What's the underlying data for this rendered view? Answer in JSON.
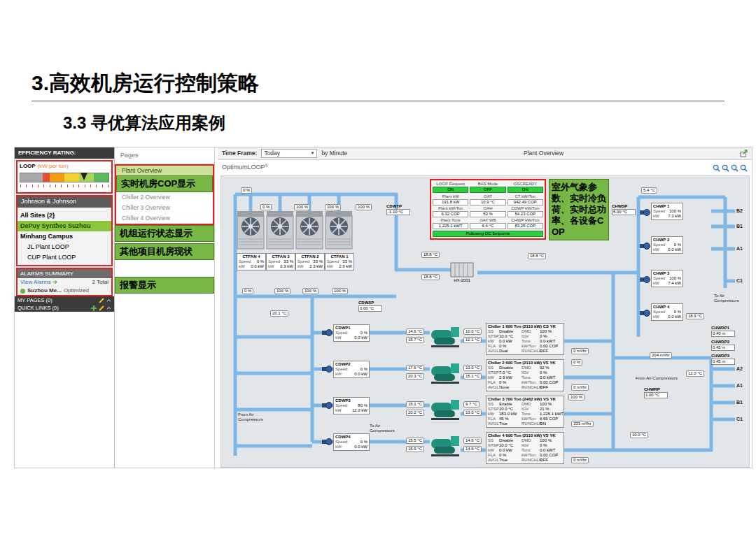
{
  "slide": {
    "title": "3.高效机房运行控制策略",
    "subtitle": "3.3 寻优算法应用案例"
  },
  "sidebar": {
    "rating_header": "EFFICIENCY RATING:",
    "gauge": {
      "label": "LOOP",
      "unit": "(kW per ton)",
      "level": 0.72
    },
    "company": "Johnson & Johnson",
    "sites": [
      {
        "label": "All Sites (2)",
        "kind": "group",
        "selected": false
      },
      {
        "label": "DePuy Synthes Suzhou",
        "kind": "site",
        "selected": true
      },
      {
        "label": "Minhang Campus",
        "kind": "group",
        "selected": false
      },
      {
        "label": "JL Plant LOOP",
        "kind": "plant",
        "selected": false
      },
      {
        "label": "CUP Plant LOOP",
        "kind": "plant",
        "selected": false
      }
    ],
    "alarms": {
      "header": "ALARMS SUMMARY",
      "link": "View Alarms",
      "arrow": "➔",
      "total": "2 Total",
      "items": [
        {
          "label": "Suzhou Me...",
          "status": "Optimized",
          "color": "#6ab04c"
        }
      ]
    },
    "footer": [
      {
        "label": "MY PAGES (0)"
      },
      {
        "label": "QUICK LINKS (0)"
      }
    ]
  },
  "pages": {
    "header": "Pages",
    "items": [
      {
        "label": "Plant Overview",
        "selected": true
      },
      {
        "label": "Chiller 2 Overview",
        "selected": false
      },
      {
        "label": "Chiller 3 Overview",
        "selected": false
      },
      {
        "label": "Chiller 4 Overview",
        "selected": false
      }
    ]
  },
  "annotations": {
    "cop": "实时机房COP显示",
    "units": "机组运行状态显示",
    "others": "其他项目机房现状",
    "alarms": "报警显示",
    "weather": "室外气象参数、实时冷负荷、实时总功率、各设备COP"
  },
  "toolbar": {
    "time_frame_label": "Time Frame:",
    "time_frame": "Today",
    "caret": "▼",
    "interval": "by Minute",
    "title": "Plant Overview"
  },
  "panel": {
    "title": "OptimumLOOP",
    "mark": "®"
  },
  "diagram": {
    "speed_label": "Speed",
    "kw_label": "kW",
    "cooling_towers": [
      {
        "name": "CTFAN 4",
        "speed": "0 %",
        "kw": "0.0 kW"
      },
      {
        "name": "CTFAN 3",
        "speed": "33 %",
        "kw": "2.3 kW"
      },
      {
        "name": "CTFAN 2",
        "speed": "33 %",
        "kw": "2.3 kW"
      },
      {
        "name": "CTFAN 1",
        "speed": "33 %",
        "kw": "2.3 kW"
      }
    ],
    "status": {
      "flags": [
        {
          "label": "LOOP Request",
          "value": "ON"
        },
        {
          "label": "BAS Mode",
          "value": "OFF"
        },
        {
          "label": "OSCREADY",
          "value": "ON"
        }
      ],
      "metrics": [
        {
          "label": "Plant kW",
          "value": "191.8 kW"
        },
        {
          "label": "OAT",
          "value": "10.9 °C"
        },
        {
          "label": "CT kW/Ton",
          "value": "942.49 COP"
        },
        {
          "label": "Plant kW/Ton",
          "value": "6.32 COP"
        },
        {
          "label": "OAH",
          "value": "53 %"
        },
        {
          "label": "CDWP kW/Ton",
          "value": "54.23 COP"
        },
        {
          "label": "Plant Tons",
          "value": "1,225.1 kWT"
        },
        {
          "label": "OAT WB",
          "value": "6.4 °C"
        },
        {
          "label": "CHWP kW/Ton",
          "value": "83.25 COP"
        }
      ],
      "footer": "Following OC Setpoints"
    },
    "condenser_pumps": [
      {
        "name": "CDWP1",
        "speed": "0 %",
        "kw": "0.0 kW"
      },
      {
        "name": "CDWP2",
        "speed": "0 %",
        "kw": "0.0 kW"
      },
      {
        "name": "CDWP3",
        "speed": "80 %",
        "kw": "12.0 kW"
      },
      {
        "name": "CDWP4",
        "speed": "0 %",
        "kw": "0.0 kW"
      }
    ],
    "chilled_pumps": [
      {
        "name": "CHWP 1",
        "speed": "100 %",
        "kw": "7.3 kW"
      },
      {
        "name": "CHWP 2",
        "speed": "0 %",
        "kw": "0.0 kW"
      },
      {
        "name": "CHWP 3",
        "speed": "100 %",
        "kw": "7.4 kW"
      },
      {
        "name": "CHWP 4",
        "speed": "0 %",
        "kw": "0.0 kW"
      }
    ],
    "chillers": [
      {
        "name": "Chiller 1 600 Ton (2110 kW) CS YK",
        "left": [
          {
            "label": "SS",
            "value": "Disable"
          },
          {
            "label": "STSP",
            "value": "10.0 °C"
          },
          {
            "label": "kW",
            "value": "0.0 kW"
          },
          {
            "label": "FLA",
            "value": "0 %"
          },
          {
            "label": "AVGL",
            "value": "Dual"
          }
        ],
        "right": [
          {
            "label": "DMD",
            "value": "100 %"
          },
          {
            "label": "IGV",
            "value": "0 %"
          },
          {
            "label": "Tons",
            "value": "0.0 kWT"
          },
          {
            "label": "kW/Ton",
            "value": "0.00 COP"
          },
          {
            "label": "RUNCHLR",
            "value": "OFF"
          }
        ]
      },
      {
        "name": "Chiller 2 600 Ton (2110 kW) VS YK",
        "left": [
          {
            "label": "SS",
            "value": "Disable"
          },
          {
            "label": "STSP",
            "value": "7.0 °C"
          },
          {
            "label": "kW",
            "value": "2.9 kW"
          },
          {
            "label": "FLA",
            "value": "0 %"
          },
          {
            "label": "AVGL",
            "value": "None"
          }
        ],
        "right": [
          {
            "label": "DMD",
            "value": "92 %"
          },
          {
            "label": "IGV",
            "value": "0 %"
          },
          {
            "label": "Tons",
            "value": "0.0 kWT"
          },
          {
            "label": "kW/Ton",
            "value": "0.00 COP"
          },
          {
            "label": "RUNCHLR",
            "value": "OFF"
          }
        ]
      },
      {
        "name": "Chiller 3 700 Ton (2462 kW) VS YK",
        "left": [
          {
            "label": "SS",
            "value": "Enable"
          },
          {
            "label": "STSP",
            "value": "10.0 °C"
          },
          {
            "label": "kW",
            "value": "183.0 kW"
          },
          {
            "label": "FLA",
            "value": "45 %"
          },
          {
            "label": "AVGL",
            "value": "True"
          }
        ],
        "right": [
          {
            "label": "DMD",
            "value": "100 %"
          },
          {
            "label": "IGV",
            "value": "21 %"
          },
          {
            "label": "Tons",
            "value": "1,225.1 kWT"
          },
          {
            "label": "kW/Ton",
            "value": "6.69 COP"
          },
          {
            "label": "RUNCHLR",
            "value": "ON"
          }
        ]
      },
      {
        "name": "Chiller 4 600 Ton (2110 kW) VS YK",
        "left": [
          {
            "label": "SS",
            "value": "Disable"
          },
          {
            "label": "STSP",
            "value": "10.0 °C"
          },
          {
            "label": "kW",
            "value": "0.0 kW"
          },
          {
            "label": "FLA",
            "value": "0 %"
          },
          {
            "label": "AVGL",
            "value": "True"
          }
        ],
        "right": [
          {
            "label": "DMD",
            "value": "100 %"
          },
          {
            "label": "IGV",
            "value": "0 %"
          },
          {
            "label": "Tons",
            "value": "0.0 kWT"
          },
          {
            "label": "kW/Ton",
            "value": "0.00 COP"
          },
          {
            "label": "RUNCHLR",
            "value": "OFF"
          }
        ]
      }
    ],
    "setpoints": [
      {
        "name": "CDWTP",
        "value": "-1.10 °C"
      },
      {
        "name": "CDWSP",
        "value": "0.00 °C"
      },
      {
        "name": "CHWSP",
        "value": "5.00 °C"
      },
      {
        "name": "CHWRP",
        "value": "1.00 °C"
      },
      {
        "name": "CHWDP1",
        "value": "0.40 m"
      },
      {
        "name": "CHWDP2",
        "value": "0.45 m"
      },
      {
        "name": "CHWDP3",
        "value": "0.45 m"
      }
    ],
    "temperatures": [
      "20.1 °C",
      "18.8 °C",
      "18.8 °C",
      "18.8 °C",
      "5.4 °C",
      "14.6 °C",
      "15.7 °C",
      "17.6 °C",
      "20.3 °C",
      "15.1 °C",
      "20.2 °C",
      "15.5 °C",
      "15.9 °C",
      "10.0 °C",
      "12.1 °C",
      "13.0 °C",
      "15.1 °C",
      "9.7 °C",
      "13.0 °C",
      "14.6 °C",
      "14.6 °C",
      "18.9 °C",
      "12.0 °C",
      "10.0 °C"
    ],
    "valves": [
      "0 %",
      "0 %",
      "100 %",
      "100 %",
      "100 %",
      "0 %",
      "100 %",
      "100 %",
      "100 %",
      "0 %",
      "100 %"
    ],
    "flows": [
      "0 m³/hr",
      "0 m³/hr",
      "333 m³/hr",
      "0 m³/hr",
      "204 m³/hr"
    ],
    "heat_exchanger": "HX-2001",
    "labels": [
      "From Air Compressors",
      "To Air Compressors",
      "To Air Compressors",
      "From Air Compressors"
    ],
    "branches": [
      "B2",
      "B1",
      "A1",
      "C1",
      "A2",
      "A1",
      "B1",
      "C1"
    ]
  }
}
